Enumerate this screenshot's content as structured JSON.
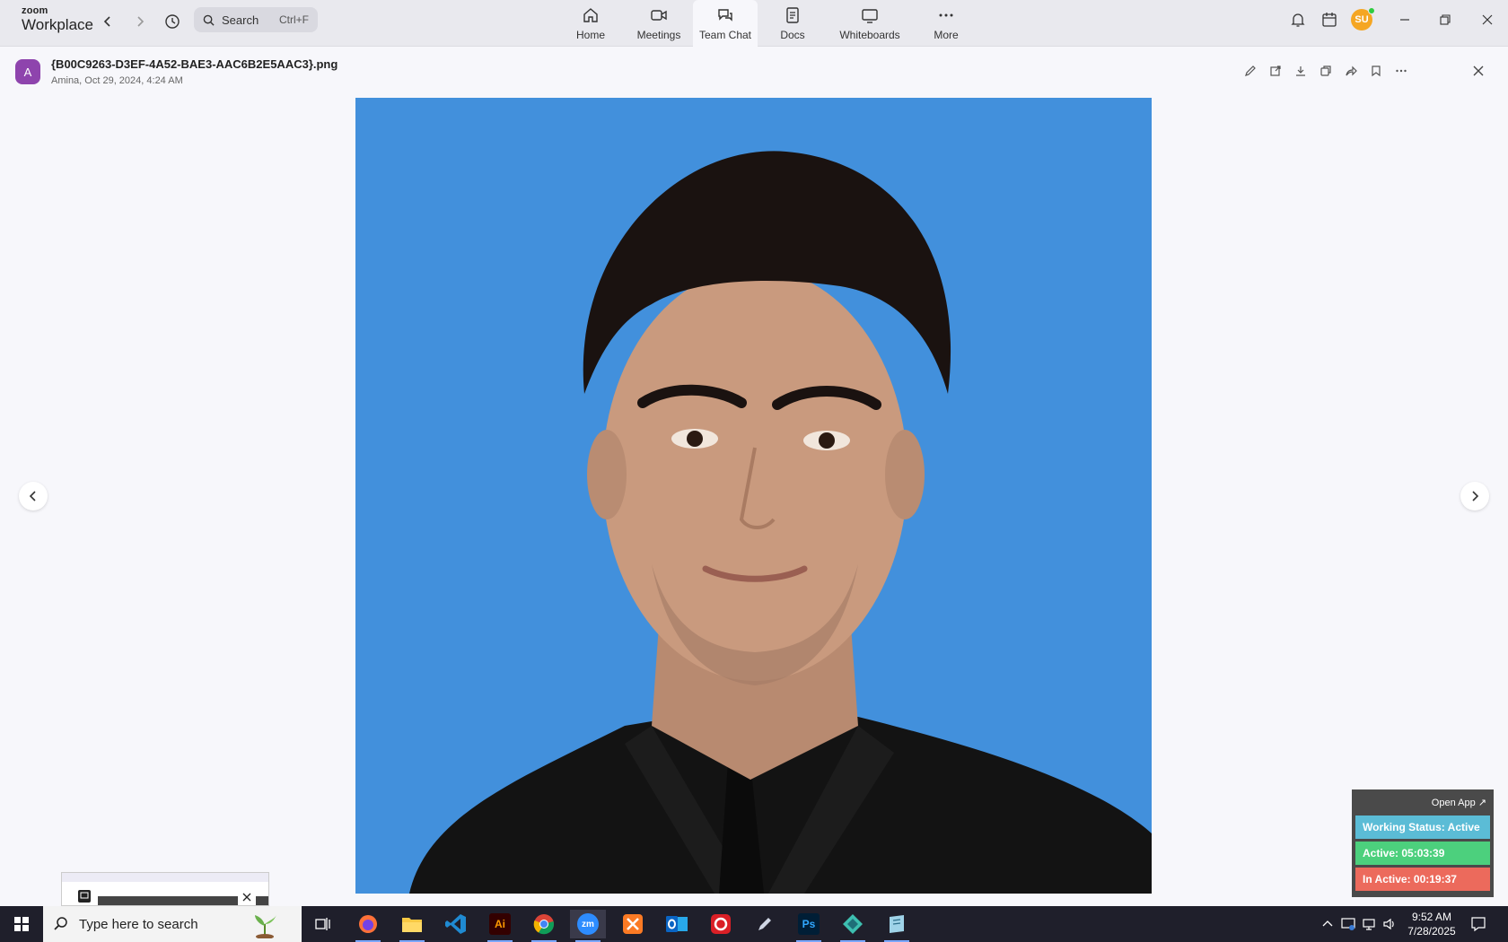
{
  "app": {
    "brand_small": "zoom",
    "brand_big": "Workplace",
    "search_label": "Search",
    "search_shortcut": "Ctrl+F"
  },
  "tabs": [
    {
      "label": "Home",
      "icon": "home-icon"
    },
    {
      "label": "Meetings",
      "icon": "video-icon"
    },
    {
      "label": "Team Chat",
      "icon": "chat-icon",
      "active": true
    },
    {
      "label": "Docs",
      "icon": "docs-icon"
    },
    {
      "label": "Whiteboards",
      "icon": "whiteboard-icon"
    },
    {
      "label": "More",
      "icon": "more-icon"
    }
  ],
  "user": {
    "initials": "SU",
    "status_color": "#2ecc40",
    "color": "#f5a623"
  },
  "file": {
    "avatar_letter": "A",
    "avatar_color": "#8e44ad",
    "name": "{B00C9263-D3EF-4A52-BAE3-AAC6B2E5AAC3}.png",
    "meta": "Amina, Oct 29, 2024, 4:24 AM"
  },
  "photo": {
    "background": "#4290dc"
  },
  "widget": {
    "open_app": "Open App ↗",
    "working_status": "Working Status: Active",
    "active": "Active: 05:03:39",
    "inactive": "In Active: 00:19:37",
    "colors": {
      "status": "#5bbcd6",
      "active": "#4cd07d",
      "inactive": "#ec6a5c"
    }
  },
  "taskbar": {
    "search_placeholder": "Type here to search",
    "time": "9:52 AM",
    "date": "7/28/2025",
    "apps": [
      "firefox-icon",
      "file-explorer-icon",
      "vscode-icon",
      "illustrator-icon",
      "chrome-icon",
      "zoom-icon",
      "xampp-icon",
      "outlook-icon",
      "creative-cloud-icon",
      "pen-tool-icon",
      "photoshop-icon",
      "app-icon",
      "notes-icon"
    ],
    "app_labels": {
      "illustrator": "Ai",
      "zoom": "zm",
      "photoshop": "Ps"
    }
  }
}
